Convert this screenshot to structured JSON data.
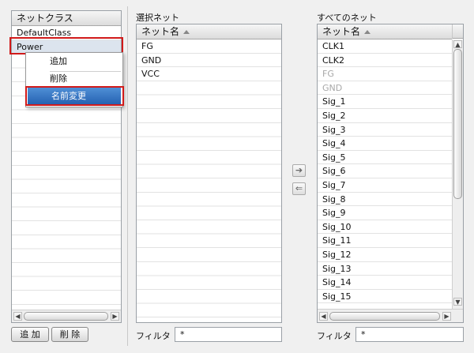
{
  "left_panel": {
    "header": "ネットクラス",
    "items": [
      "DefaultClass",
      "Power"
    ],
    "add_button": "追 加",
    "delete_button": "削 除"
  },
  "context_menu": {
    "items": [
      "追加",
      "削除",
      "名前変更"
    ],
    "selected": "名前変更"
  },
  "middle_panel": {
    "title": "選択ネット",
    "column_header": "ネット名",
    "rows": [
      "FG",
      "GND",
      "VCC"
    ],
    "filter_label": "フィルタ",
    "filter_value": "*"
  },
  "right_panel": {
    "title": "すべてのネット",
    "column_header": "ネット名",
    "rows": [
      {
        "name": "CLK1",
        "dim": false
      },
      {
        "name": "CLK2",
        "dim": false
      },
      {
        "name": "FG",
        "dim": true
      },
      {
        "name": "GND",
        "dim": true
      },
      {
        "name": "Sig_1",
        "dim": false
      },
      {
        "name": "Sig_2",
        "dim": false
      },
      {
        "name": "Sig_3",
        "dim": false
      },
      {
        "name": "Sig_4",
        "dim": false
      },
      {
        "name": "Sig_5",
        "dim": false
      },
      {
        "name": "Sig_6",
        "dim": false
      },
      {
        "name": "Sig_7",
        "dim": false
      },
      {
        "name": "Sig_8",
        "dim": false
      },
      {
        "name": "Sig_9",
        "dim": false
      },
      {
        "name": "Sig_10",
        "dim": false
      },
      {
        "name": "Sig_11",
        "dim": false
      },
      {
        "name": "Sig_12",
        "dim": false
      },
      {
        "name": "Sig_13",
        "dim": false
      },
      {
        "name": "Sig_14",
        "dim": false
      },
      {
        "name": "Sig_15",
        "dim": false
      }
    ],
    "filter_label": "フィルタ",
    "filter_value": "*"
  },
  "transfer": {
    "add_icon": "arrow-right-icon",
    "remove_icon": "arrow-left-icon",
    "add_glyph": "➔",
    "remove_glyph": "⇐"
  },
  "scroll_glyphs": {
    "left": "◀",
    "right": "▶",
    "up": "▲",
    "down": "▼"
  },
  "colors": {
    "highlight_border": "#d11a1a",
    "menu_selected": "#2d6bbf",
    "dimmed_text": "#a8a8a8"
  }
}
